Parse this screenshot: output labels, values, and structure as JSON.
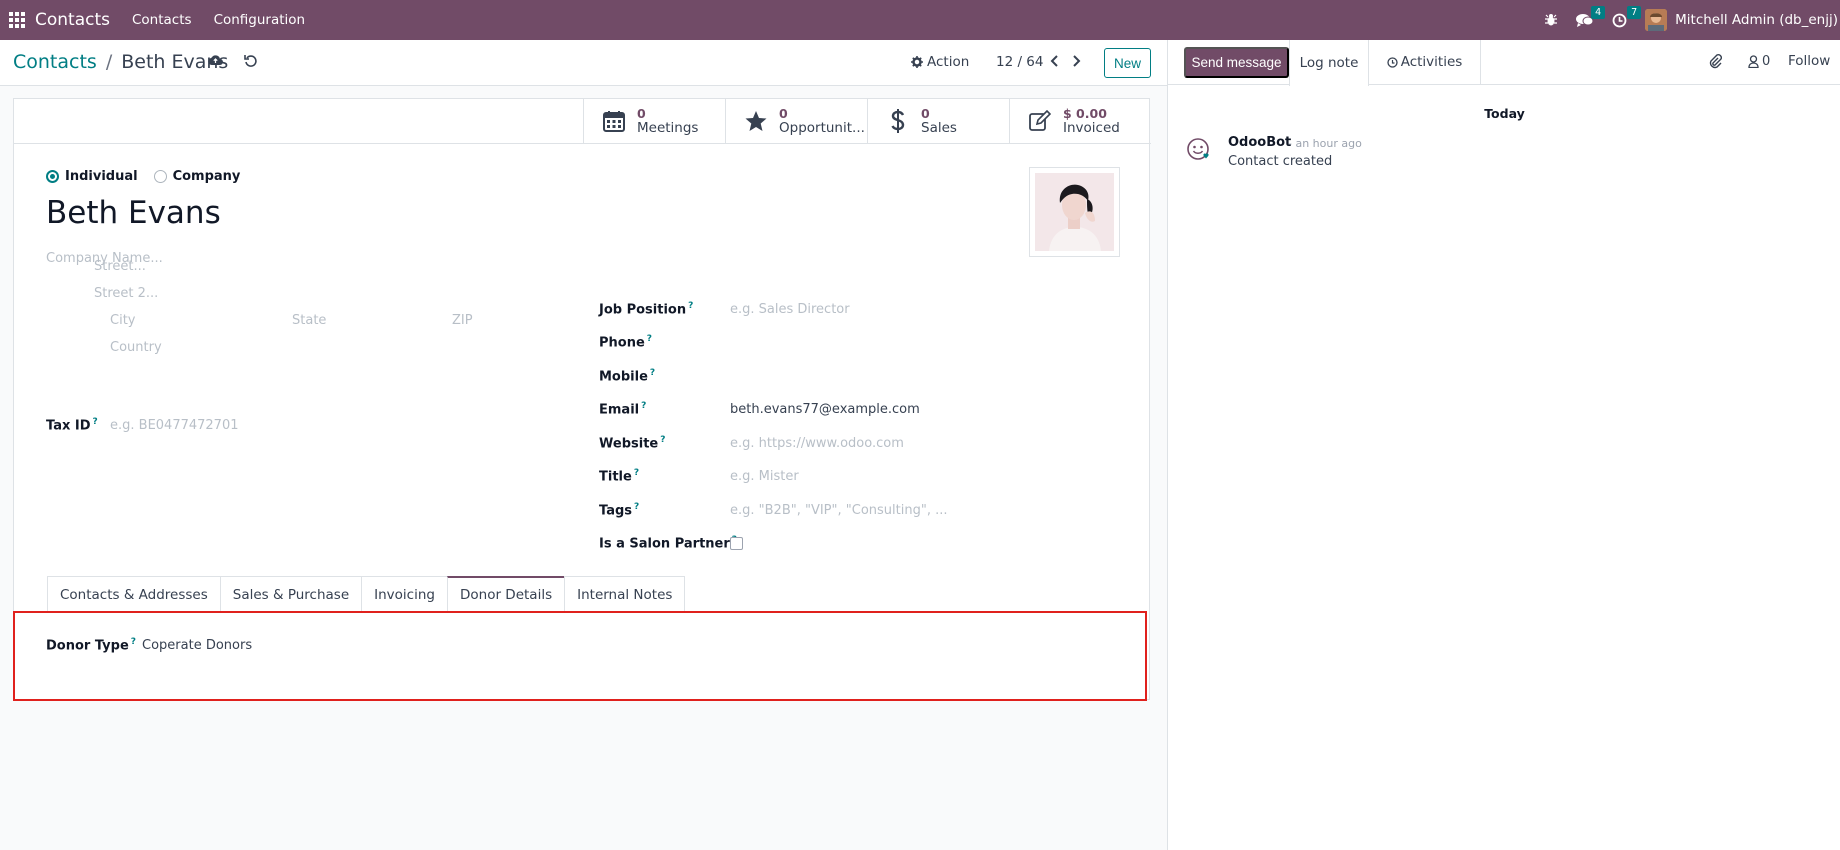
{
  "navbar": {
    "app_name": "Contacts",
    "menus": [
      "Contacts",
      "Configuration"
    ],
    "messages_count": "4",
    "activities_count": "7",
    "user_name": "Mitchell Admin (db_enjj)"
  },
  "control_panel": {
    "breadcrumb_parent": "Contacts",
    "breadcrumb_current": "Beth Evans",
    "action_label": "Action",
    "pager": "12 / 64",
    "new_label": "New"
  },
  "smart_buttons": [
    {
      "value": "0",
      "label": "Meetings",
      "icon": "calendar-icon"
    },
    {
      "value": "0",
      "label": "Opportunit...",
      "icon": "star-icon"
    },
    {
      "value": "0",
      "label": "Sales",
      "icon": "dollar-icon"
    },
    {
      "value": "$ 0.00",
      "label": "Invoiced",
      "icon": "edit-icon"
    }
  ],
  "form": {
    "type_individual": "Individual",
    "type_company": "Company",
    "name": "Beth Evans",
    "company_placeholder": "Company Name...",
    "street_placeholder": "Street...",
    "street2_placeholder": "Street 2...",
    "city_placeholder": "City",
    "state_placeholder": "State",
    "zip_placeholder": "ZIP",
    "country_placeholder": "Country",
    "tax_id_label": "Tax ID",
    "tax_id_placeholder": "e.g. BE0477472701",
    "job_position_label": "Job Position",
    "job_position_placeholder": "e.g. Sales Director",
    "phone_label": "Phone",
    "mobile_label": "Mobile",
    "email_label": "Email",
    "email_value": "beth.evans77@example.com",
    "website_label": "Website",
    "website_placeholder": "e.g. https://www.odoo.com",
    "title_label": "Title",
    "title_placeholder": "e.g. Mister",
    "tags_label": "Tags",
    "tags_placeholder": "e.g. \"B2B\", \"VIP\", \"Consulting\", ...",
    "salon_label": "Is a Salon Partner",
    "help_mark": "?"
  },
  "tabs": [
    "Contacts & Addresses",
    "Sales & Purchase",
    "Invoicing",
    "Donor Details",
    "Internal Notes"
  ],
  "donor": {
    "label": "Donor Type",
    "value": "Coperate Donors"
  },
  "chatter": {
    "send_message": "Send message",
    "log_note": "Log note",
    "activities": "Activities",
    "followers_count": "0",
    "follow": "Follow",
    "today": "Today",
    "message_author": "OdooBot",
    "message_time": "- an hour ago",
    "message_body": "Contact created"
  },
  "colors": {
    "brand": "#714b67",
    "accent": "#017e84",
    "highlight": "#e0211d"
  }
}
